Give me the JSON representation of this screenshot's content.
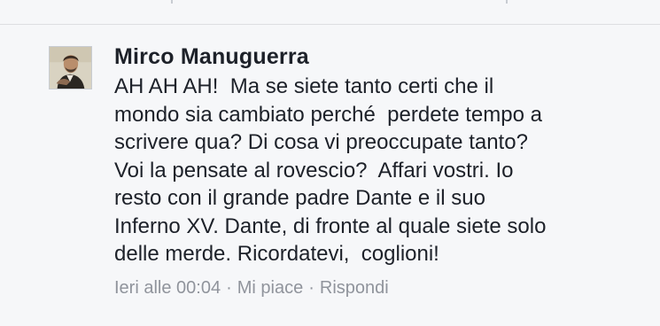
{
  "comment": {
    "avatar_icon": "profile-photo",
    "author": "Mirco Manuguerra",
    "body_lines": [
      "AH AH AH!  Ma se siete tanto certi che il",
      "mondo sia cambiato perché  perdete tempo a",
      "scrivere qua? Di cosa vi preoccupate tanto?",
      "Voi la pensate al rovescio?  Affari vostri. Io",
      "resto con il grande padre Dante e il suo",
      "Inferno XV. Dante, di fronte al quale siete solo",
      "delle merde. Ricordatevi,  coglioni!"
    ],
    "timestamp": "Ieri alle 00:04",
    "separator": "·",
    "like_label": "Mi piace",
    "reply_label": "Rispondi"
  },
  "colors": {
    "background": "#f6f7f9",
    "text": "#1d2129",
    "meta": "#90949c",
    "divider": "#dddfe2"
  }
}
